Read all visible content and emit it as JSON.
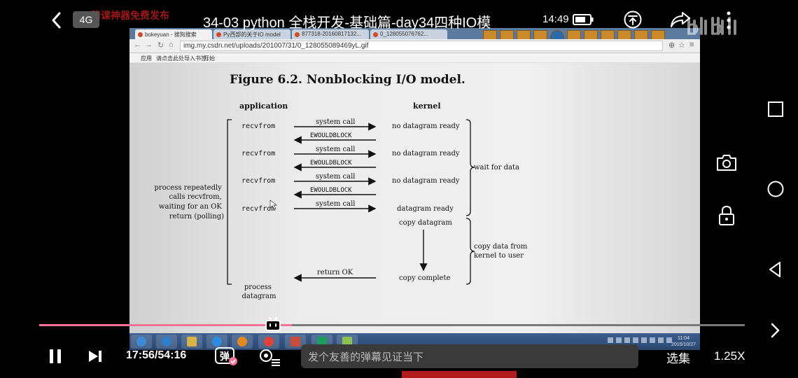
{
  "status_bar": {
    "network": "4G",
    "time": "14:49"
  },
  "header": {
    "title": "34-03 python 全栈开发-基础篇-day34四种IO模",
    "watermark": "精课神器免费发布"
  },
  "browser": {
    "tabs": [
      "bokeyuan - 搜狗搜索",
      "Py西部的关于IO model",
      "877318-20160817132...",
      "0_128055076762..."
    ],
    "url": "img.my.csdn.net/uploads/201007/31/0_128055089469yL.gif",
    "bookmarks": {
      "apps": "应用",
      "hint": "请点击此处导入书签。",
      "start": "开始"
    }
  },
  "figure": {
    "title": "Figure 6.2. Nonblocking I/O model.",
    "col_application": "application",
    "col_kernel": "kernel",
    "calls": [
      "recvfrom",
      "recvfrom",
      "recvfrom",
      "recvfrom"
    ],
    "syscall": "system call",
    "ewouldblock": "EWOULDBLOCK",
    "no_datagram": "no datagram ready",
    "datagram_ready": "datagram ready",
    "copy_datagram": "copy datagram",
    "copy_complete": "copy complete",
    "return_ok": "return OK",
    "wait_for_data": "wait for data",
    "copy_data_1": "copy data from",
    "copy_data_2": "kernel to user",
    "left_note": [
      "process repeatedly",
      "calls recvfrom,",
      "waiting for an OK",
      "return (polling)"
    ],
    "process_1": "process",
    "process_2": "datagram"
  },
  "taskbar": {
    "clock_time": "11:04",
    "clock_date": "2016/10/27"
  },
  "player": {
    "progress_fraction": 0.358,
    "elapsed": "17:56",
    "duration": "54:16",
    "time_label": "17:56/54:16",
    "danmaku_toggle": "弹",
    "danmaku_placeholder": "发个友善的弹幕见证当下",
    "episodes": "选集",
    "speed": "1.25X"
  },
  "colors": {
    "progress": "#fb7299",
    "background": "#000000"
  }
}
